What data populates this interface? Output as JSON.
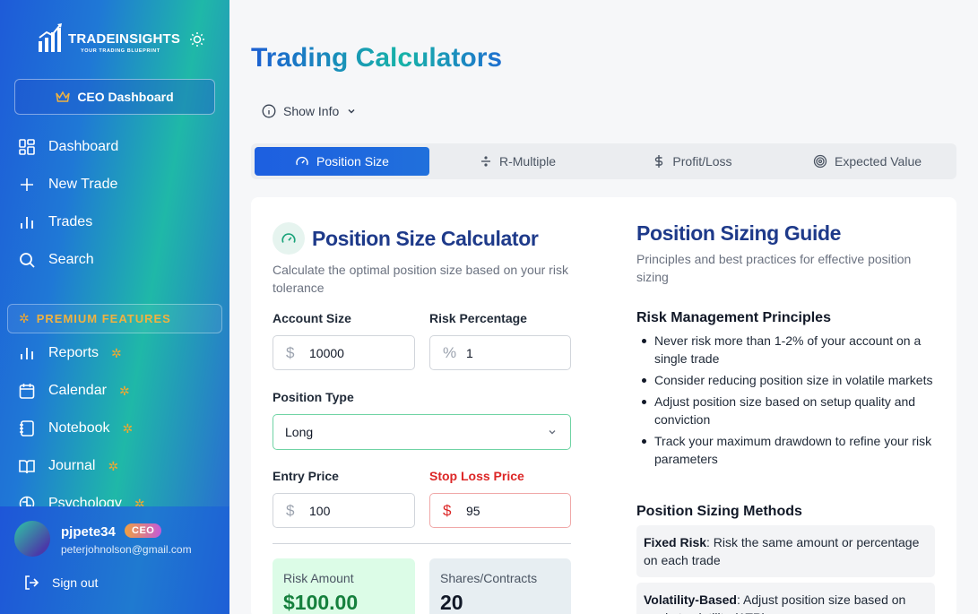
{
  "brand": {
    "name": "TRADEINSIGHTS",
    "tagline": "YOUR TRADING BLUEPRINT"
  },
  "sidebar": {
    "ceo_button": "CEO Dashboard",
    "nav": [
      {
        "label": "Dashboard",
        "icon": "grid-icon"
      },
      {
        "label": "New Trade",
        "icon": "plus-icon"
      },
      {
        "label": "Trades",
        "icon": "bar-chart-icon"
      },
      {
        "label": "Search",
        "icon": "search-icon"
      }
    ],
    "premium_label": "PREMIUM FEATURES",
    "premium_nav": [
      {
        "label": "Reports",
        "icon": "bar-chart-icon"
      },
      {
        "label": "Calendar",
        "icon": "calendar-icon"
      },
      {
        "label": "Notebook",
        "icon": "notebook-icon"
      },
      {
        "label": "Journal",
        "icon": "book-icon"
      },
      {
        "label": "Psychology",
        "icon": "brain-icon"
      }
    ],
    "user": {
      "name": "pjpete34",
      "badge": "CEO",
      "email": "peterjohnolson@gmail.com"
    },
    "sign_out": "Sign out"
  },
  "main": {
    "title": "Trading Calculators",
    "show_info": "Show Info",
    "tabs": [
      {
        "label": "Position Size",
        "icon": "gauge-icon",
        "active": true
      },
      {
        "label": "R-Multiple",
        "icon": "divide-icon",
        "active": false
      },
      {
        "label": "Profit/Loss",
        "icon": "dollar-icon",
        "active": false
      },
      {
        "label": "Expected Value",
        "icon": "target-icon",
        "active": false
      }
    ],
    "calculator": {
      "title": "Position Size Calculator",
      "subtitle": "Calculate the optimal position size based on your risk tolerance",
      "account_size_label": "Account Size",
      "account_size_prefix": "$",
      "account_size_value": "10000",
      "risk_pct_label": "Risk Percentage",
      "risk_pct_prefix": "%",
      "risk_pct_value": "1",
      "position_type_label": "Position Type",
      "position_type_value": "Long",
      "entry_label": "Entry Price",
      "entry_prefix": "$",
      "entry_value": "100",
      "stop_label": "Stop Loss Price",
      "stop_prefix": "$",
      "stop_value": "95",
      "risk_amount_label": "Risk Amount",
      "risk_amount_value": "$100.00",
      "shares_label": "Shares/Contracts",
      "shares_value": "20"
    },
    "guide": {
      "title": "Position Sizing Guide",
      "subtitle": "Principles and best practices for effective position sizing",
      "principles_heading": "Risk Management Principles",
      "principles": [
        "Never risk more than 1-2% of your account on a single trade",
        "Consider reducing position size in volatile markets",
        "Adjust position size based on setup quality and conviction",
        "Track your maximum drawdown to refine your risk parameters"
      ],
      "methods_heading": "Position Sizing Methods",
      "methods": [
        {
          "name": "Fixed Risk",
          "desc": ": Risk the same amount or percentage on each trade"
        },
        {
          "name": "Volatility-Based",
          "desc": ": Adjust position size based on market volatility (ATR)"
        }
      ]
    }
  },
  "colors": {
    "accent": "#1d5fe0",
    "teal": "#17b3a8",
    "premium": "#f0b240",
    "danger": "#dc2626",
    "heading": "#1e3a8a"
  }
}
